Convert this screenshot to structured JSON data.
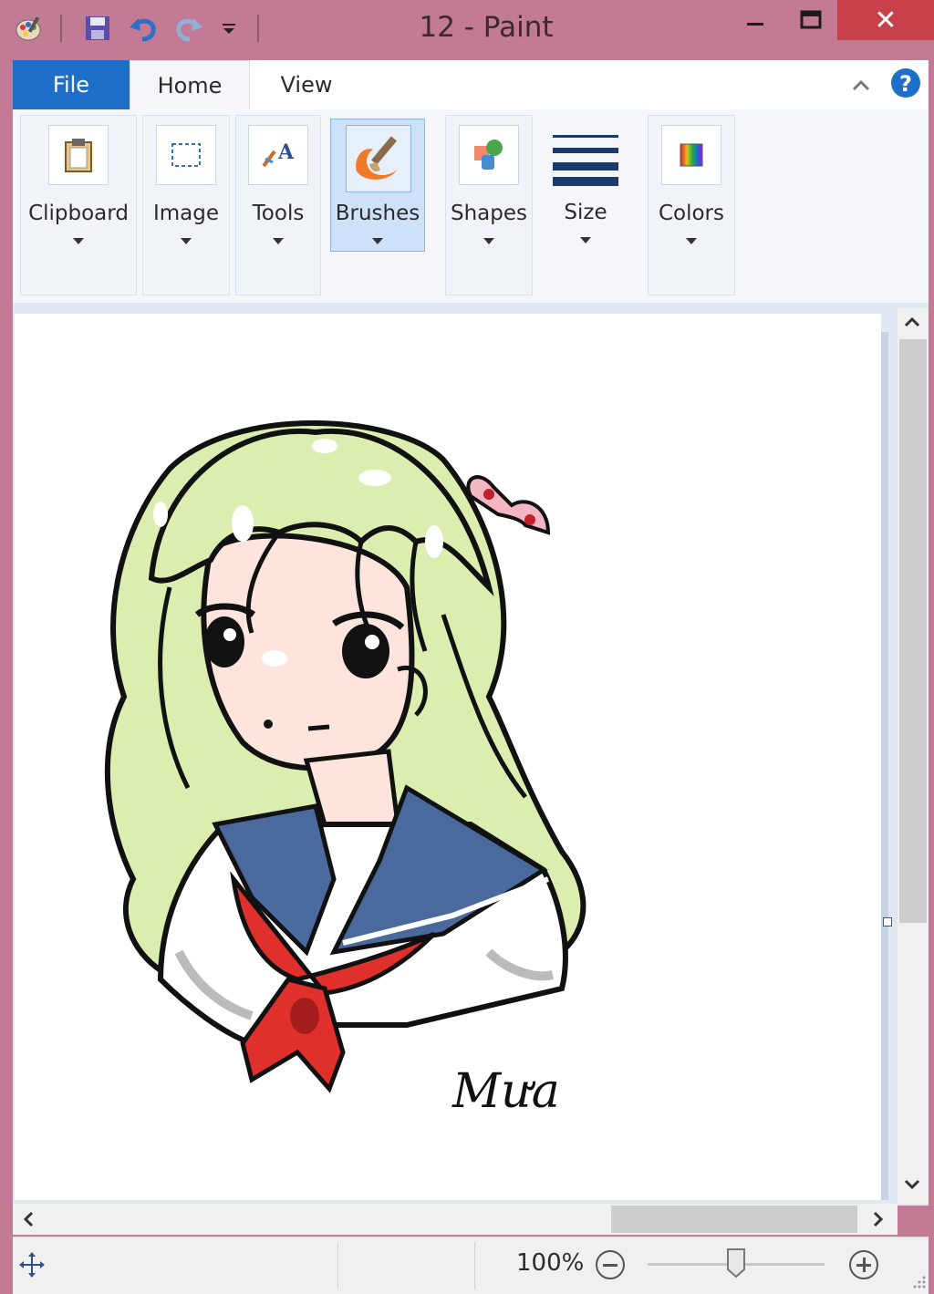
{
  "window": {
    "title": "12 - Paint",
    "accent": "#c37a94",
    "close_color": "#c8404a"
  },
  "quick_access": {
    "icons": [
      "paint-app-icon",
      "save-icon",
      "undo-icon",
      "redo-icon",
      "customize-quick-access-icon"
    ]
  },
  "ribbon": {
    "tabs": [
      {
        "label": "File",
        "color": "#1e6fc9"
      },
      {
        "label": "Home",
        "selected": true
      },
      {
        "label": "View"
      }
    ],
    "groups": [
      {
        "label": "Clipboard",
        "icon": "clipboard-icon"
      },
      {
        "label": "Image",
        "icon": "select-icon"
      },
      {
        "label": "Tools",
        "icon": "tools-icon"
      },
      {
        "label": "Brushes",
        "icon": "brush-icon",
        "selected": true
      },
      {
        "label": "Shapes",
        "icon": "shapes-icon"
      },
      {
        "label": "Size",
        "icon": "size-icon"
      },
      {
        "label": "Colors",
        "icon": "colors-icon"
      }
    ]
  },
  "canvas": {
    "signature": "Mưa",
    "description_colors": {
      "hair": "#dcedb0",
      "skin": "#fde4dd",
      "collar": "#4a6a9e",
      "scarf": "#e0302c",
      "shirt": "#ffffff"
    }
  },
  "status": {
    "zoom": "100%",
    "zoom_level_percent": 100
  }
}
